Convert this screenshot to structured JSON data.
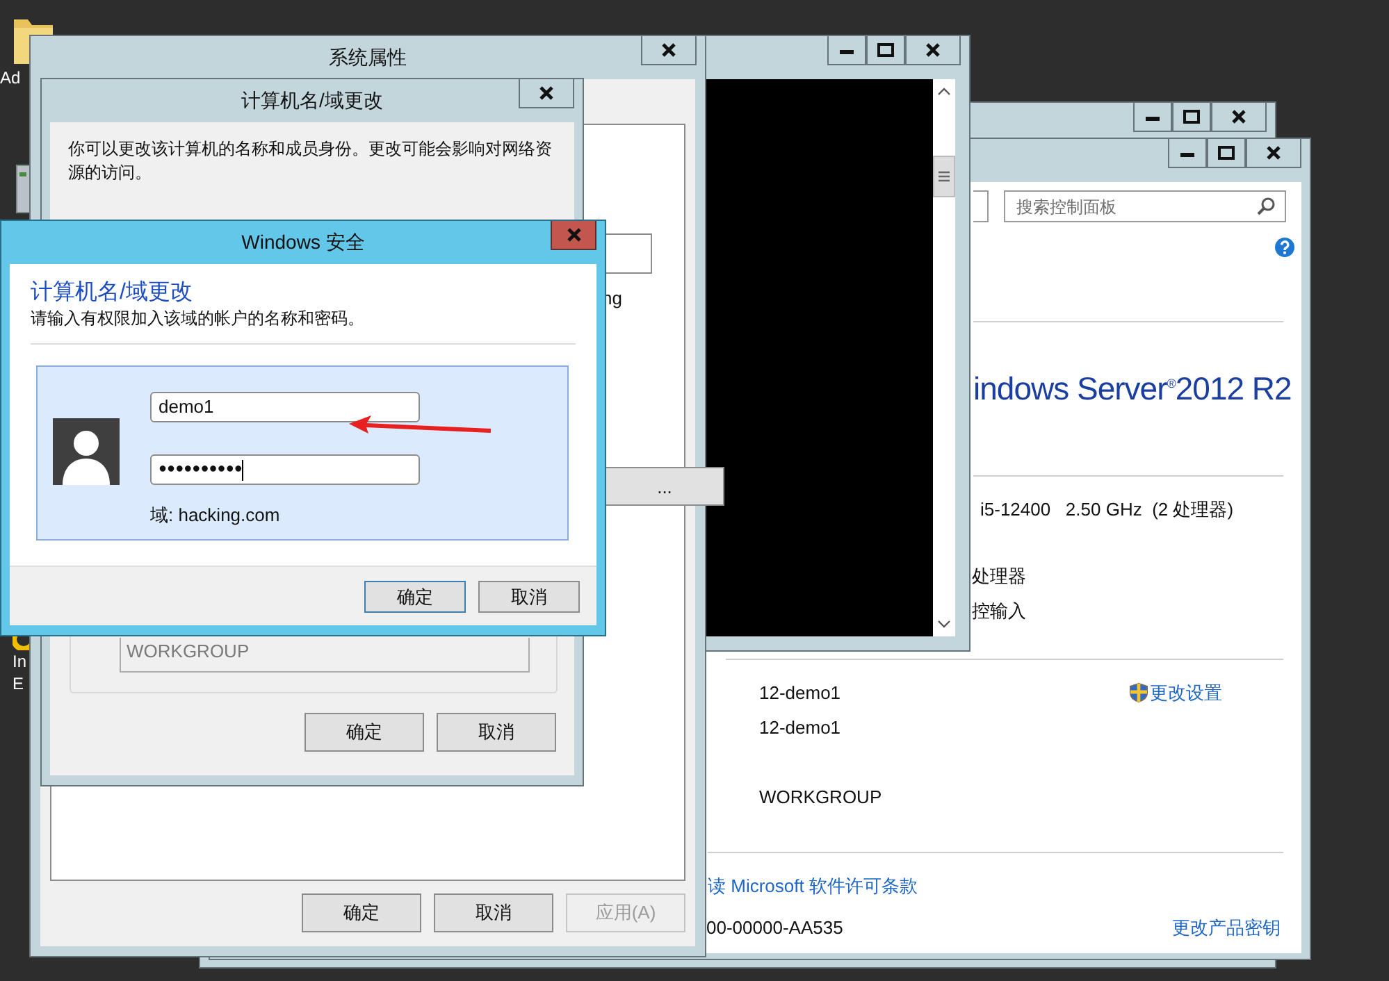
{
  "desktop_icons": [
    {
      "kind": "folder",
      "label_lines": [
        "Ad"
      ]
    },
    {
      "kind": "drive"
    },
    {
      "kind": "browser",
      "label_lines": [
        "In",
        "E"
      ]
    }
  ],
  "control_panel": {
    "search": {
      "placeholder": "搜索控制面板"
    },
    "edition": "indows Server$^{®}$2012 R2",
    "processor": "i5-12400   2.50 GHz  (2 处理器)",
    "system_type": "处理器",
    "pen_touch": "控输入",
    "computer_name": "12-demo1",
    "full_name": "12-demo1",
    "change_settings": "更改设置",
    "workgroup": "WORKGROUP",
    "license_link": "读 Microsoft 软件许可条款",
    "product_id": "00-00000-AA535",
    "change_key": "更改产品密钥"
  },
  "system_properties": {
    "title": "系统属性",
    "fragment_text": "ng",
    "fragment_button": "...",
    "buttons": [
      {
        "label": "确定",
        "disabled": false
      },
      {
        "label": "取消",
        "disabled": false
      },
      {
        "label": "应用(A)",
        "disabled": true
      }
    ]
  },
  "computer_name_dialog": {
    "title": "计算机名/域更改",
    "description": "你可以更改该计算机的名称和成员身份。更改可能会影响对网络资源的访问。",
    "workgroup_field": {
      "value": "WORKGROUP",
      "disabled": true
    },
    "buttons": [
      "确定",
      "取消"
    ]
  },
  "security_dialog": {
    "title": "Windows 安全",
    "heading": "计算机名/域更改",
    "instruction": "请输入有权限加入该域的帐户的名称和密码。",
    "username": {
      "value": "demo1"
    },
    "password": {
      "value": "●●●●●●●●●●",
      "focused": true
    },
    "domain": "域: hacking.com",
    "buttons": [
      {
        "label": "确定",
        "default": true
      },
      {
        "label": "取消",
        "default": false
      }
    ]
  }
}
